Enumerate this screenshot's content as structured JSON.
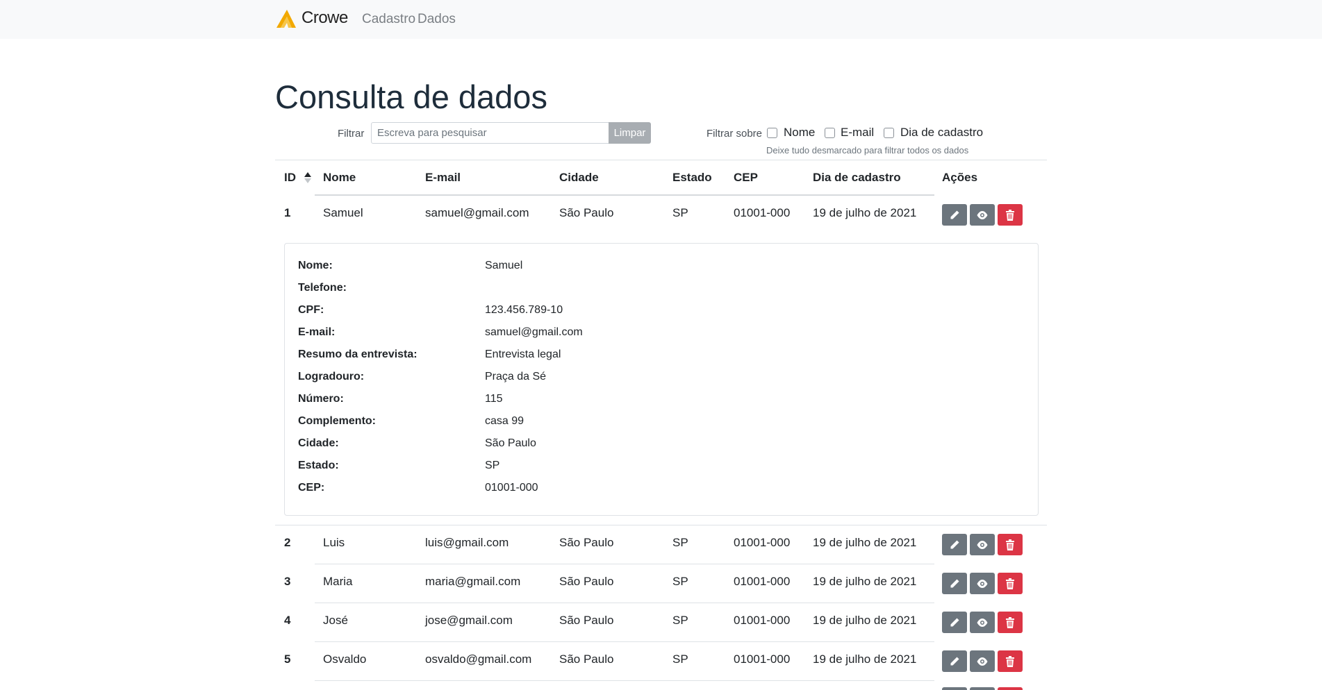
{
  "navbar": {
    "brand": "Crowe",
    "links": [
      {
        "label": "Cadastro"
      },
      {
        "label": "Dados"
      }
    ]
  },
  "page_title": "Consulta de dados",
  "filter": {
    "label": "Filtrar",
    "placeholder": "Escreva para pesquisar",
    "value": "",
    "clear_label": "Limpar",
    "over_label": "Filtrar sobre",
    "options": [
      {
        "label": "Nome",
        "checked": false
      },
      {
        "label": "E-mail",
        "checked": false
      },
      {
        "label": "Dia de cadastro",
        "checked": false
      }
    ],
    "hint": "Deixe tudo desmarcado para filtrar todos os dados"
  },
  "table": {
    "columns": [
      "ID",
      "Nome",
      "E-mail",
      "Cidade",
      "Estado",
      "CEP",
      "Dia de cadastro",
      "Ações"
    ],
    "sort": {
      "column": "ID",
      "direction": "asc"
    },
    "rows": [
      {
        "id": "1",
        "nome": "Samuel",
        "email": "samuel@gmail.com",
        "cidade": "São Paulo",
        "estado": "SP",
        "cep": "01001-000",
        "dia": "19 de julho de 2021"
      },
      {
        "id": "2",
        "nome": "Luis",
        "email": "luis@gmail.com",
        "cidade": "São Paulo",
        "estado": "SP",
        "cep": "01001-000",
        "dia": "19 de julho de 2021"
      },
      {
        "id": "3",
        "nome": "Maria",
        "email": "maria@gmail.com",
        "cidade": "São Paulo",
        "estado": "SP",
        "cep": "01001-000",
        "dia": "19 de julho de 2021"
      },
      {
        "id": "4",
        "nome": "José",
        "email": "jose@gmail.com",
        "cidade": "São Paulo",
        "estado": "SP",
        "cep": "01001-000",
        "dia": "19 de julho de 2021"
      },
      {
        "id": "5",
        "nome": "Osvaldo",
        "email": "osvaldo@gmail.com",
        "cidade": "São Paulo",
        "estado": "SP",
        "cep": "01001-000",
        "dia": "19 de julho de 2021"
      }
    ],
    "action_icons": [
      "pencil-icon",
      "eye-icon",
      "trash-icon"
    ]
  },
  "details": [
    {
      "label": "Nome:",
      "value": "Samuel"
    },
    {
      "label": "Telefone:",
      "value": ""
    },
    {
      "label": "CPF:",
      "value": "123.456.789-10"
    },
    {
      "label": "E-mail:",
      "value": "samuel@gmail.com"
    },
    {
      "label": "Resumo da entrevista:",
      "value": "Entrevista legal"
    },
    {
      "label": "Logradouro:",
      "value": "Praça da Sé"
    },
    {
      "label": "Número:",
      "value": "115"
    },
    {
      "label": "Complemento:",
      "value": "casa 99"
    },
    {
      "label": "Cidade:",
      "value": "São Paulo"
    },
    {
      "label": "Estado:",
      "value": "SP"
    },
    {
      "label": "CEP:",
      "value": "01001-000"
    }
  ],
  "colors": {
    "navbar_bg": "#f8f9fa",
    "secondary": "#6c757d",
    "danger": "#dc3545",
    "title": "#1e2d3b",
    "brand_accent": "#f2a900"
  }
}
